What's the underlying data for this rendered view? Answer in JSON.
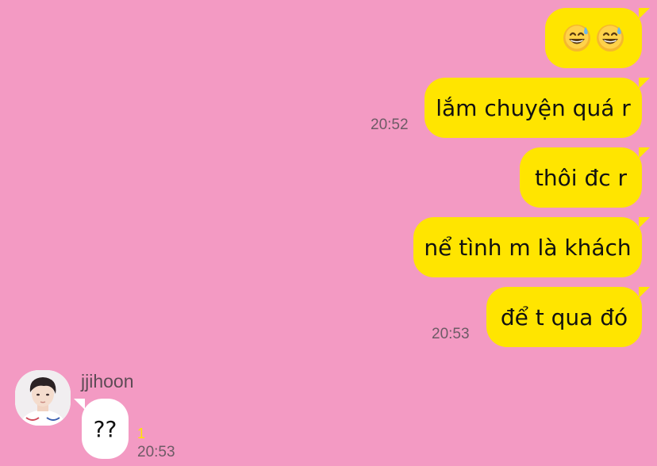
{
  "colors": {
    "background": "#f39ac3",
    "my_bubble": "#ffe500",
    "their_bubble": "#ffffff",
    "unread_badge": "#ffe500"
  },
  "messages_outgoing": [
    {
      "text": "",
      "icons": [
        "grinning-sweat-emoji",
        "grinning-sweat-emoji"
      ],
      "time": ""
    },
    {
      "text": "lắm chuyện quá r",
      "time": "20:52"
    },
    {
      "text": "thôi đc r",
      "time": ""
    },
    {
      "text": "nể tình m là khách",
      "time": ""
    },
    {
      "text": "để t qua đó",
      "time": "20:53"
    }
  ],
  "incoming": {
    "sender_name": "jjihoon",
    "avatar_icon": "profile-photo",
    "message": "??",
    "unread_count": "1",
    "time": "20:53"
  }
}
